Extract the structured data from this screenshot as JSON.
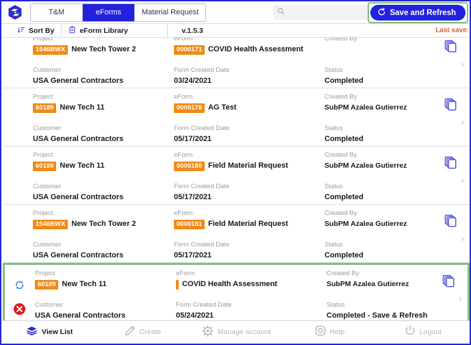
{
  "header": {
    "logo_name": "app-logo",
    "tabs": [
      {
        "label": "T&M",
        "active": false
      },
      {
        "label": "eForms",
        "active": true
      },
      {
        "label": "Material Request",
        "active": false
      }
    ],
    "search": {
      "value": "",
      "placeholder": ""
    },
    "save_button": {
      "label": "Save and Refresh"
    }
  },
  "toolbar": {
    "sort_by": "Sort By",
    "eform_library": "eForm Library",
    "version": "v.1.5.3",
    "last_save": "Last save:"
  },
  "labels": {
    "project": "Project",
    "eform": "eForm",
    "created_by": "Created By",
    "customer": "Customer",
    "form_created_date": "Form Created Date",
    "status": "Status"
  },
  "rows": [
    {
      "project_code": "1546BWX",
      "project_name": "New Tech Tower 2",
      "eform_code": "0000171",
      "eform_name": "COVID Health Assessment",
      "created_by": "",
      "customer": "USA General Contractors",
      "form_created_date": "03/24/2021",
      "status": "Completed",
      "highlighted": false,
      "has_sync_icon": false,
      "has_error_icon": false,
      "partial": true
    },
    {
      "project_code": "60189",
      "project_name": "New Tech 11",
      "eform_code": "0000178",
      "eform_name": "AG Test",
      "created_by": "SubPM Azalea Gutierrez",
      "customer": "USA General Contractors",
      "form_created_date": "05/17/2021",
      "status": "Completed",
      "highlighted": false,
      "has_sync_icon": false,
      "has_error_icon": false,
      "partial": false
    },
    {
      "project_code": "60189",
      "project_name": "New Tech 11",
      "eform_code": "0000180",
      "eform_name": "Field Material Request",
      "created_by": "SubPM Azalea Gutierrez",
      "customer": "USA General Contractors",
      "form_created_date": "05/17/2021",
      "status": "Completed",
      "highlighted": false,
      "has_sync_icon": false,
      "has_error_icon": false,
      "partial": false
    },
    {
      "project_code": "1546BWX",
      "project_name": "New Tech Tower 2",
      "eform_code": "0000181",
      "eform_name": "Field Material Request",
      "created_by": "SubPM Azalea Gutierrez",
      "customer": "USA General Contractors",
      "form_created_date": "05/17/2021",
      "status": "Completed",
      "highlighted": false,
      "has_sync_icon": false,
      "has_error_icon": false,
      "partial": false
    },
    {
      "project_code": "60189",
      "project_name": "New Tech 11",
      "eform_code": "",
      "eform_name": "COVID Health Assessment",
      "created_by": "SubPM Azalea Gutierrez",
      "customer": "USA General Contractors",
      "form_created_date": "05/24/2021",
      "status": "Completed - Save & Refresh",
      "highlighted": true,
      "has_sync_icon": true,
      "has_error_icon": true,
      "partial": false
    }
  ],
  "bottom_nav": [
    {
      "label": "View List",
      "icon": "layers-icon",
      "active": true
    },
    {
      "label": "Create",
      "icon": "pencil-icon",
      "active": false
    },
    {
      "label": "Manage account",
      "icon": "gear-icon",
      "active": false
    },
    {
      "label": "Help",
      "icon": "lifebuoy-icon",
      "active": false
    },
    {
      "label": "Logout",
      "icon": "power-icon",
      "active": false
    }
  ],
  "colors": {
    "primary_blue": "#2222dd",
    "badge_orange": "#f08a18",
    "highlight_green": "#7fc07f",
    "error_red": "#e01b1b",
    "last_save_orange": "#e2603a"
  }
}
